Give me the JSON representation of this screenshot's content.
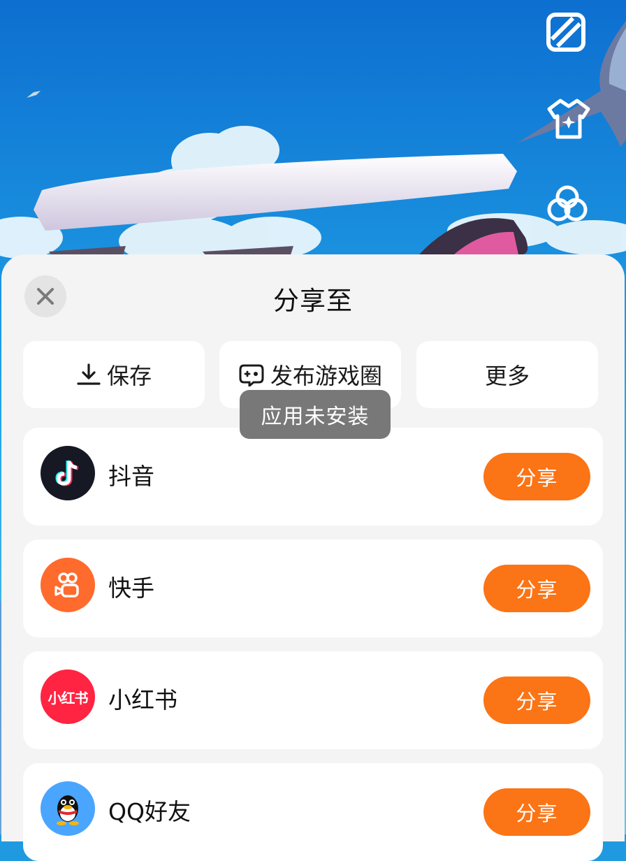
{
  "side_tools": [
    {
      "name": "layout-toggle-icon"
    },
    {
      "name": "outfit-icon"
    },
    {
      "name": "circles-icon"
    }
  ],
  "sheet": {
    "title": "分享至",
    "close_icon": "close-icon"
  },
  "actions": [
    {
      "label": "保存",
      "icon": "download-icon"
    },
    {
      "label": "发布游戏圈",
      "icon": "gamepad-icon"
    },
    {
      "label": "更多",
      "icon": ""
    }
  ],
  "toast": "应用未安装",
  "apps": [
    {
      "name": "抖音",
      "icon": "douyin-icon",
      "color": "#161823",
      "share_label": "分享"
    },
    {
      "name": "快手",
      "icon": "kuaishou-icon",
      "color": "#ff6a2d",
      "share_label": "分享"
    },
    {
      "name": "小红书",
      "icon": "xiaohongshu-icon",
      "color": "#ff2442",
      "share_label": "分享",
      "icon_text": "小红书"
    },
    {
      "name": "QQ好友",
      "icon": "qq-icon",
      "color": "#4aa5ff",
      "share_label": "分享"
    }
  ],
  "colors": {
    "accent": "#fb7416",
    "sheet_bg": "#f4f4f4",
    "sky": "#1f9ae0"
  }
}
